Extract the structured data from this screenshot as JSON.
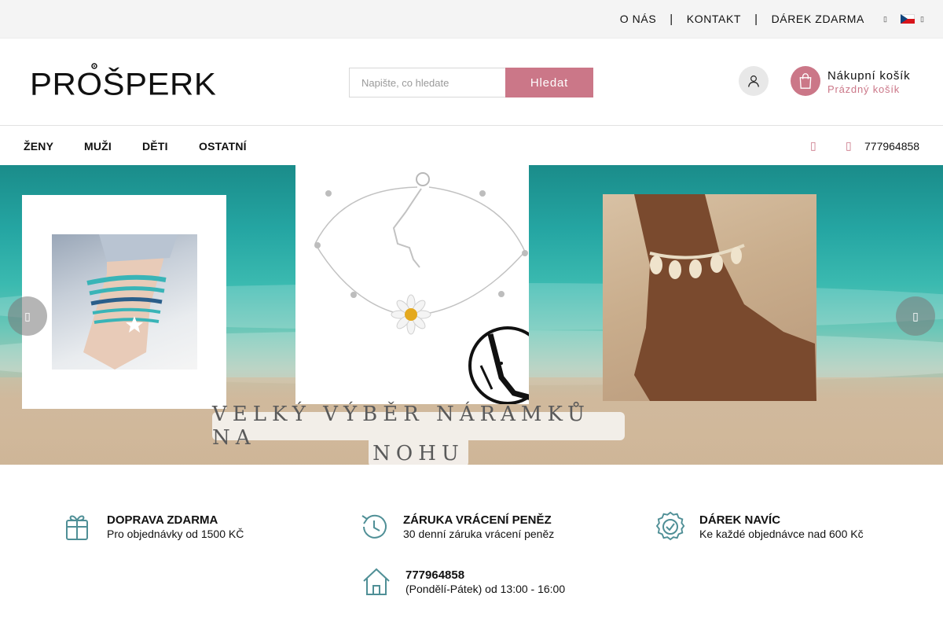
{
  "topbar": {
    "links": [
      "O NÁS",
      "KONTAKT",
      "DÁREK ZDARMA"
    ],
    "separator": "|",
    "misc_glyph": "▯",
    "lang_caret": "▯",
    "flag_icon": "czech-flag"
  },
  "header": {
    "logo_text": "PROŠPERK",
    "search": {
      "placeholder": "Napište, co hledate",
      "button_label": "Hledat"
    },
    "account_icon": "user-icon",
    "cart": {
      "icon": "shopping-bag-icon",
      "title": "Nákupní košík",
      "subtitle": "Prázdný košík"
    }
  },
  "nav": {
    "items": [
      "ŽENY",
      "MUŽI",
      "DĚTI",
      "OSTATNÍ"
    ],
    "glyph_a": "▯",
    "glyph_b": "▯",
    "phone": "777964858"
  },
  "banner": {
    "caption_line1": "VELKÝ VÝBĚR NÁRAMKŮ NA",
    "caption_line2": "NOHU",
    "prev_label": "▯",
    "next_label": "▯"
  },
  "features": [
    {
      "icon": "gift-icon",
      "title": "DOPRAVA ZDARMA",
      "subtitle": "Pro objednávky od 1500 KČ"
    },
    {
      "icon": "history-icon",
      "title": "ZÁRUKA VRÁCENÍ PENĚZ",
      "subtitle": "30 denní záruka vrácení peněz"
    },
    {
      "icon": "badge-check-icon",
      "title": "DÁREK NAVÍC",
      "subtitle": "Ke každé objednávce nad 600 Kč"
    },
    {
      "icon": "home-icon",
      "title": "777964858",
      "subtitle": "(Pondělí-Pátek) od 13:00 - 16:00"
    }
  ],
  "colors": {
    "accent": "#cb7788",
    "feature_icon": "#4f8f96",
    "topbar_bg": "#f4f4f4"
  }
}
